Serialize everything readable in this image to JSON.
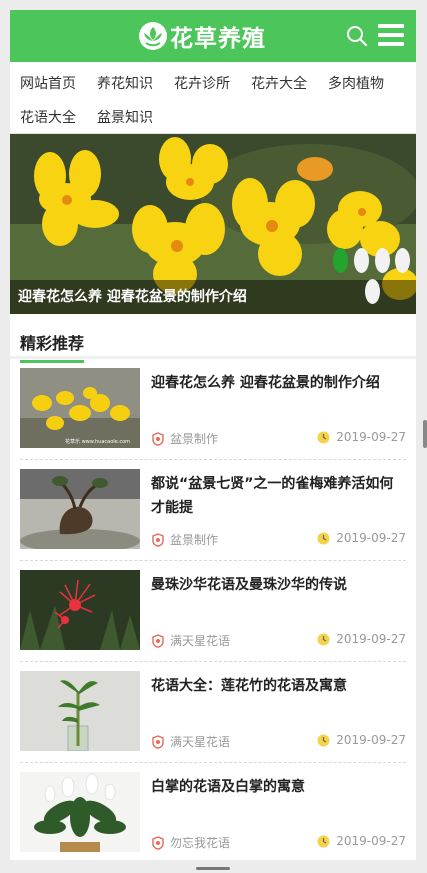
{
  "header": {
    "logo_text": "花草养殖",
    "logo_icon": "lotus-icon",
    "search_icon": "search-icon",
    "menu_icon": "menu-icon",
    "bg_color": "#4cc55a"
  },
  "nav": {
    "row1": [
      "网站首页",
      "养花知识",
      "花卉诊所",
      "花卉大全",
      "多肉植物"
    ],
    "row2": [
      "花语大全",
      "盆景知识"
    ]
  },
  "banner": {
    "caption": "迎春花怎么养 迎春花盆景的制作介绍",
    "slide_count": 5,
    "active_slide": 1
  },
  "section": {
    "title": "精彩推荐",
    "accent": "#4cc55a"
  },
  "articles": [
    {
      "title": "迎春花怎么养 迎春花盆景的制作介绍",
      "category": "盆景制作",
      "date": "2019-09-27",
      "thumb_watermark": "花草乐 www.huacaole.com"
    },
    {
      "title": "都说“盆景七贤”之一的雀梅难养活如何才能提",
      "category": "盆景制作",
      "date": "2019-09-27"
    },
    {
      "title": "曼珠沙华花语及曼珠沙华的传说",
      "category": "满天星花语",
      "date": "2019-09-27"
    },
    {
      "title": "花语大全：莲花竹的花语及寓意",
      "category": "满天星花语",
      "date": "2019-09-27"
    },
    {
      "title": "白掌的花语及白掌的寓意",
      "category": "勿忘我花语",
      "date": "2019-09-27"
    }
  ]
}
